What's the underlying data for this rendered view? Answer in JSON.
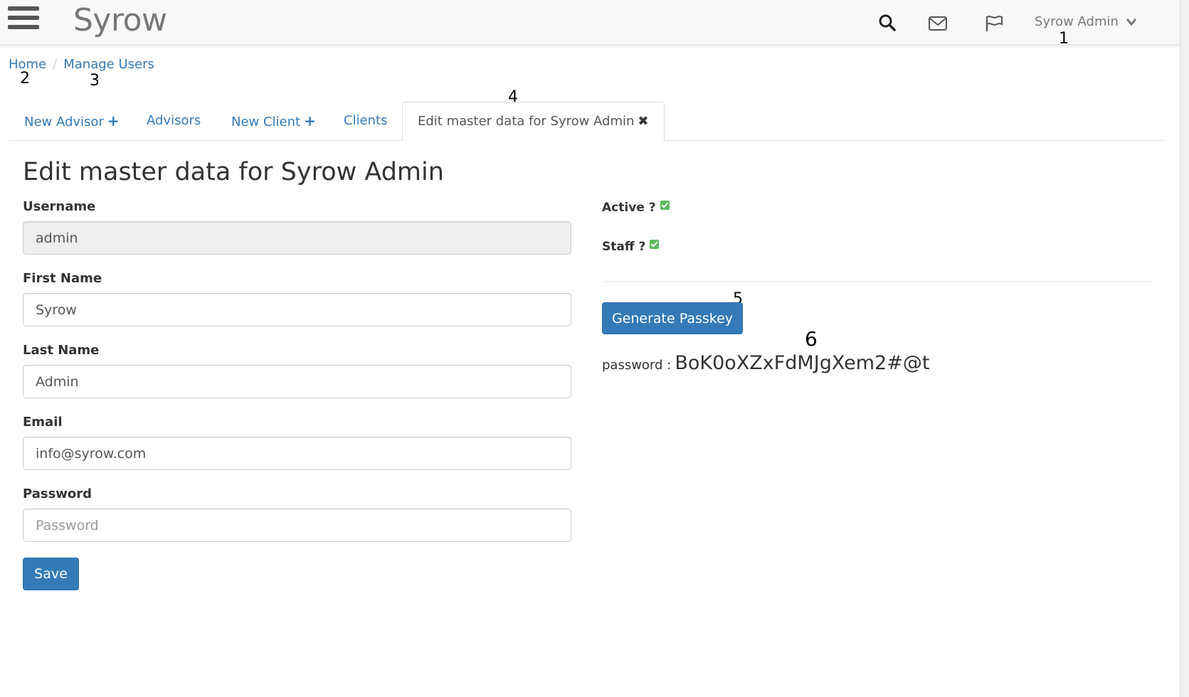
{
  "navbar": {
    "brand": "Syrow",
    "user_menu_label": "Syrow Admin",
    "icons": [
      "menu-icon",
      "search-icon",
      "envelope-icon",
      "flag-icon",
      "chevron-down-icon"
    ]
  },
  "markers": [
    "1",
    "2",
    "3",
    "4",
    "5",
    "6"
  ],
  "breadcrumb": {
    "items": [
      "Home",
      "Manage Users"
    ],
    "separator": "/"
  },
  "tabs": [
    {
      "label": "New Advisor",
      "suffix": "+"
    },
    {
      "label": "Advisors"
    },
    {
      "label": "New Client",
      "suffix": "+"
    },
    {
      "label": "Clients"
    },
    {
      "label": "Edit master data for Syrow Admin",
      "suffix": "✖",
      "active": true
    }
  ],
  "page": {
    "title": "Edit master data for Syrow Admin"
  },
  "form": {
    "username": {
      "label": "Username",
      "value": "admin"
    },
    "first_name": {
      "label": "First Name",
      "value": "Syrow"
    },
    "last_name": {
      "label": "Last Name",
      "value": "Admin"
    },
    "email": {
      "label": "Email",
      "value": "info@syrow.com"
    },
    "password": {
      "label": "Password",
      "placeholder": "Password",
      "value": ""
    },
    "save_label": "Save"
  },
  "flags": {
    "active": {
      "label": "Active ?",
      "checked": true
    },
    "staff": {
      "label": "Staff ?",
      "checked": true
    }
  },
  "passkey": {
    "button_label": "Generate Passkey",
    "password_label": "password :",
    "password_value": "BoK0oXZxFdMJgXem2#@t"
  },
  "colors": {
    "primary": "#337ab7",
    "check": "#5cb85c",
    "navbar_bg": "#f8f8f8"
  }
}
